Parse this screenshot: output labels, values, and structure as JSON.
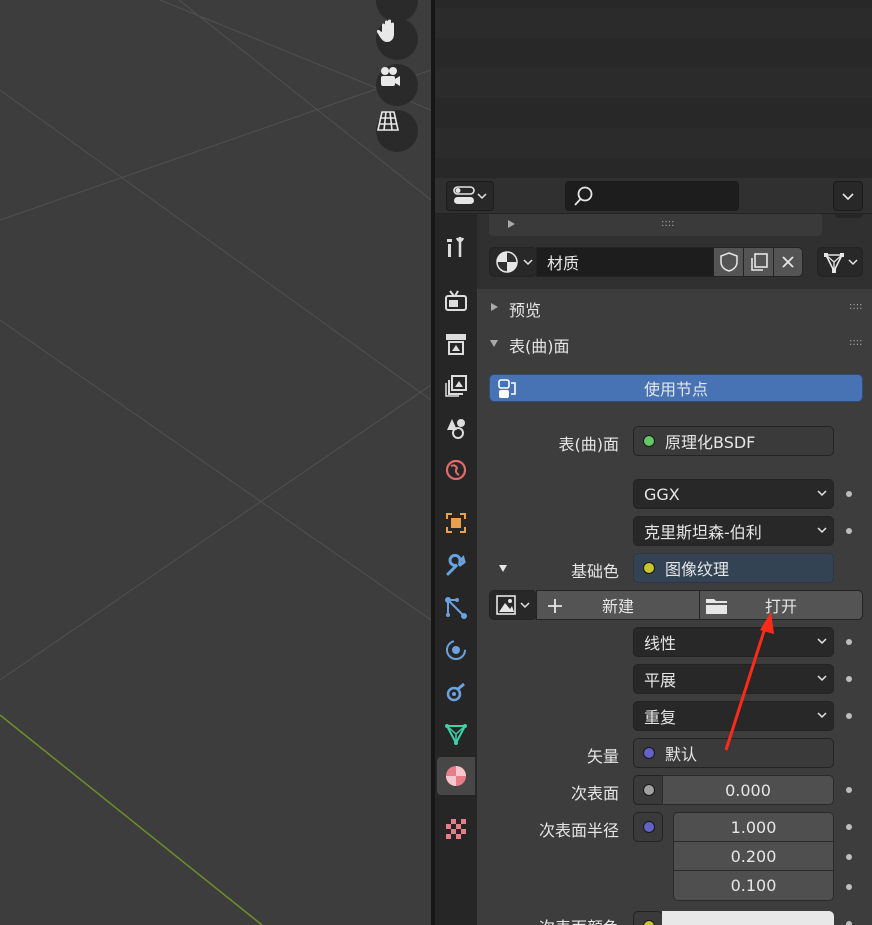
{
  "viewport": {
    "nav_buttons": [
      {
        "name": "zoom-icon"
      },
      {
        "name": "hand-pan-icon"
      },
      {
        "name": "camera-view-icon"
      },
      {
        "name": "orthographic-grid-icon"
      }
    ]
  },
  "properties": {
    "header": {
      "search_placeholder": "",
      "editor_type_icon": "properties-editor-icon",
      "options_icon": "chevron-down-icon"
    },
    "tabs": [
      {
        "name": "tool",
        "icon": "tool-icon"
      },
      {
        "name": "render",
        "icon": "render-icon"
      },
      {
        "name": "output",
        "icon": "output-icon"
      },
      {
        "name": "view-layer",
        "icon": "view-layer-icon"
      },
      {
        "name": "scene",
        "icon": "scene-icon"
      },
      {
        "name": "world",
        "icon": "world-icon"
      },
      {
        "name": "object",
        "icon": "object-icon"
      },
      {
        "name": "modifiers",
        "icon": "wrench-icon"
      },
      {
        "name": "particles",
        "icon": "particles-icon"
      },
      {
        "name": "physics",
        "icon": "physics-icon"
      },
      {
        "name": "constraints",
        "icon": "constraints-icon"
      },
      {
        "name": "object-data",
        "icon": "mesh-data-icon"
      },
      {
        "name": "material",
        "icon": "material-icon",
        "active": true
      },
      {
        "name": "texture",
        "icon": "checker-texture-icon"
      }
    ],
    "material_slot": {
      "name": "材质",
      "grip": "::::"
    },
    "panels": {
      "preview": "预览",
      "surface": "表(曲)面",
      "grip": "::::"
    },
    "use_nodes_label": "使用节点",
    "surface": {
      "shader_label": "表(曲)面",
      "shader_value": "原理化BSDF",
      "distribution": "GGX",
      "subsurface_method": "克里斯坦森-伯利",
      "base_color_label": "基础色",
      "base_color_value": "图像纹理",
      "image_new": "新建",
      "image_open": "打开",
      "interpolation": "线性",
      "projection": "平展",
      "extension": "重复",
      "vector_label": "矢量",
      "vector_value": "默认",
      "subsurface_label": "次表面",
      "subsurface_value": "0.000",
      "subsurface_radius_label": "次表面半径",
      "subsurface_radius": [
        "1.000",
        "0.200",
        "0.100"
      ],
      "subsurface_color_label": "次表面颜色"
    },
    "colors": {
      "accent": "#4772b3",
      "shader_dot": "#63c763",
      "color_dot": "#c7c729",
      "vector_dot": "#6363c7",
      "float_dot": "#a1a1a1",
      "annotation_arrow": "#ff2a1a"
    }
  }
}
